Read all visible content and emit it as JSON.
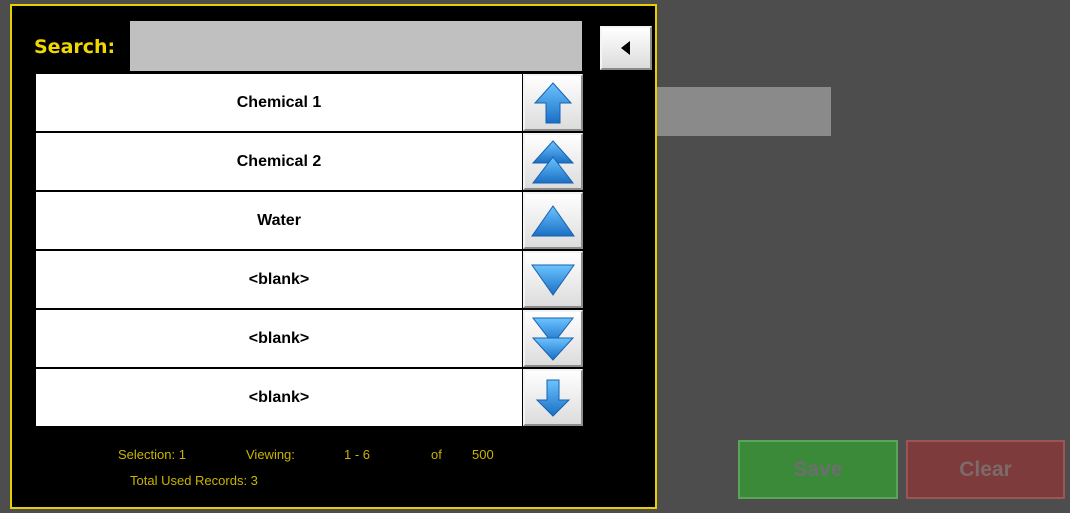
{
  "search": {
    "label": "Search:",
    "value": "",
    "placeholder": ""
  },
  "list": {
    "items": [
      "Chemical 1",
      "Chemical 2",
      "Water",
      "<blank>",
      "<blank>",
      "<blank>"
    ]
  },
  "status": {
    "selection_label": "Selection: 1",
    "viewing_label": "Viewing:",
    "range": "1 - 6",
    "of_label": "of",
    "total": "500",
    "total_used": "Total Used Records:  3"
  },
  "buttons": {
    "save": "Save",
    "clear": "Clear"
  },
  "colors": {
    "panel_border": "#e8d000",
    "search_label": "#f0d800",
    "status_text": "#c8b400",
    "arrow_blue": "#2d8fe0",
    "save_bg": "#3a8a3a",
    "clear_bg": "#7e3b3b"
  },
  "icons": {
    "back": "triangle-left-icon",
    "arrows": [
      "arrow-up-icon",
      "double-triangle-up-icon",
      "triangle-up-icon",
      "triangle-down-icon",
      "double-triangle-down-icon",
      "arrow-down-icon"
    ]
  }
}
